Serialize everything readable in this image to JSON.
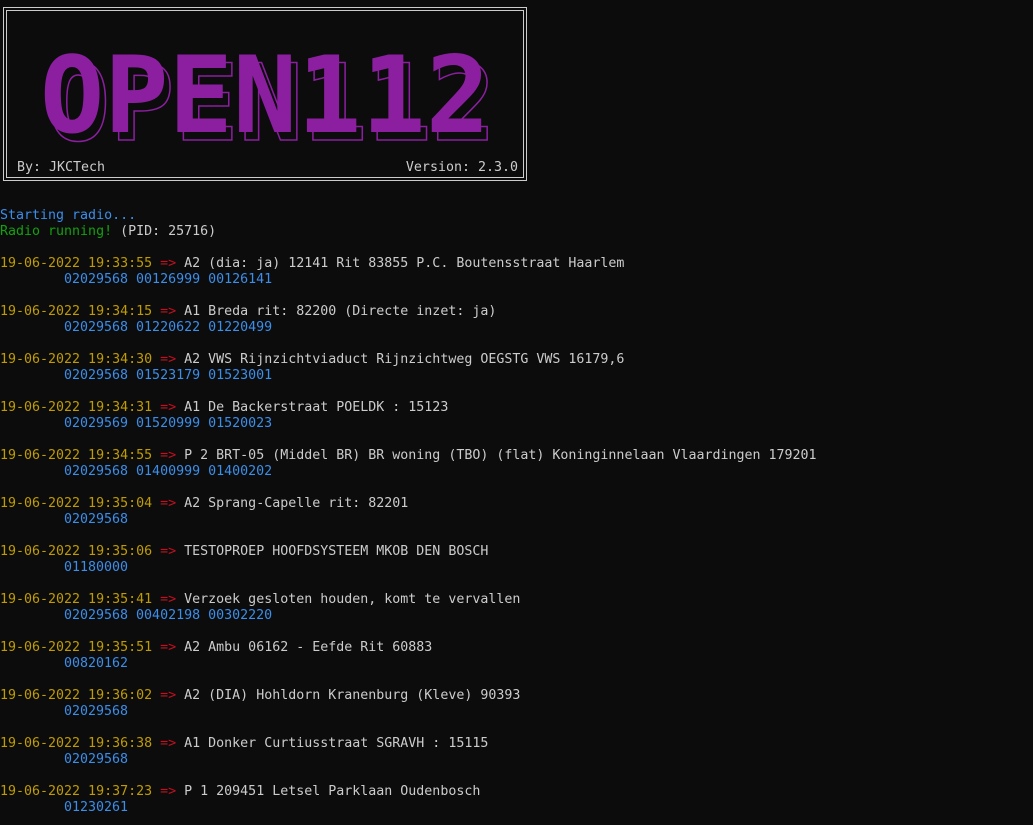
{
  "banner": {
    "logo_text": "OPEN112",
    "by": "By: JKCTech",
    "version": "Version: 2.3.0",
    "logo_color": "#8b1fa0"
  },
  "status": {
    "starting": "Starting radio...",
    "running": "Radio running!",
    "pid": " (PID: 25716)"
  },
  "arrow": "=>",
  "messages": [
    {
      "timestamp": "19-06-2022 19:33:55",
      "text": "A2 (dia: ja) 12141 Rit 83855 P.C. Boutensstraat Haarlem",
      "capcodes": "02029568 00126999 00126141"
    },
    {
      "timestamp": "19-06-2022 19:34:15",
      "text": "A1 Breda rit: 82200 (Directe inzet: ja)",
      "capcodes": "02029568 01220622 01220499"
    },
    {
      "timestamp": "19-06-2022 19:34:30",
      "text": "A2 VWS Rijnzichtviaduct Rijnzichtweg OEGSTG VWS 16179,6",
      "capcodes": "02029568 01523179 01523001"
    },
    {
      "timestamp": "19-06-2022 19:34:31",
      "text": "A1 De Backerstraat POELDK : 15123",
      "capcodes": "02029569 01520999 01520023"
    },
    {
      "timestamp": "19-06-2022 19:34:55",
      "text": "P 2 BRT-05 (Middel BR) BR woning (TBO) (flat) Koninginnelaan Vlaardingen 179201",
      "capcodes": "02029568 01400999 01400202"
    },
    {
      "timestamp": "19-06-2022 19:35:04",
      "text": "A2 Sprang-Capelle rit: 82201",
      "capcodes": "02029568"
    },
    {
      "timestamp": "19-06-2022 19:35:06",
      "text": "TESTOPROEP HOOFDSYSTEEM MKOB DEN BOSCH",
      "capcodes": "01180000"
    },
    {
      "timestamp": "19-06-2022 19:35:41",
      "text": "Verzoek gesloten houden, komt te vervallen",
      "capcodes": "02029568 00402198 00302220"
    },
    {
      "timestamp": "19-06-2022 19:35:51",
      "text": "A2 Ambu 06162 - Eefde Rit 60883",
      "capcodes": "00820162"
    },
    {
      "timestamp": "19-06-2022 19:36:02",
      "text": "A2 (DIA) Hohldorn Kranenburg (Kleve) 90393",
      "capcodes": "02029568"
    },
    {
      "timestamp": "19-06-2022 19:36:38",
      "text": "A1 Donker Curtiusstraat SGRAVH : 15115",
      "capcodes": "02029568"
    },
    {
      "timestamp": "19-06-2022 19:37:23",
      "text": "P 1 209451 Letsel Parklaan Oudenbosch",
      "capcodes": "01230261"
    }
  ]
}
